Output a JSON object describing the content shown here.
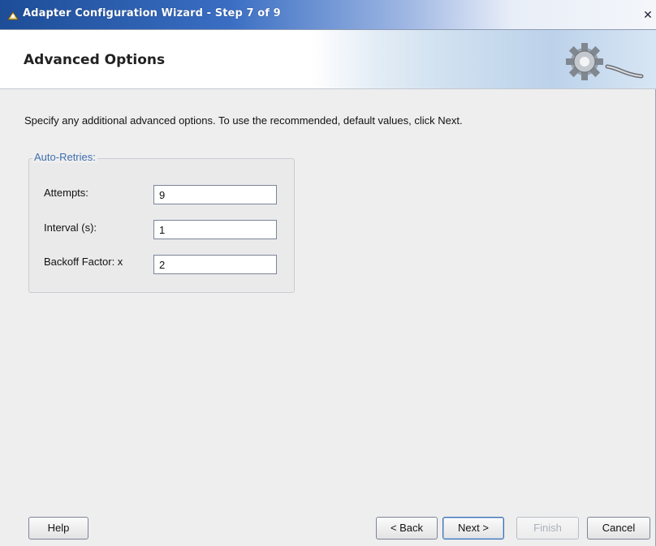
{
  "window": {
    "title": "Adapter Configuration Wizard - Step 7 of 9",
    "close_glyph": "✕"
  },
  "header": {
    "title": "Advanced Options"
  },
  "description": "Specify any additional advanced options.  To use the recommended, default values, click Next.",
  "auto_retries": {
    "legend": "Auto-Retries:",
    "fields": [
      {
        "label": "Attempts:",
        "value": "9"
      },
      {
        "label": "Interval (s):",
        "value": "1"
      },
      {
        "label": "Backoff Factor: x",
        "value": "2"
      }
    ]
  },
  "buttons": {
    "help": "Help",
    "back": "< Back",
    "next": "Next >",
    "finish": "Finish",
    "cancel": "Cancel"
  },
  "icons": {
    "title_icon": "wizard-icon",
    "header_icon": "gear-plug-icon"
  }
}
